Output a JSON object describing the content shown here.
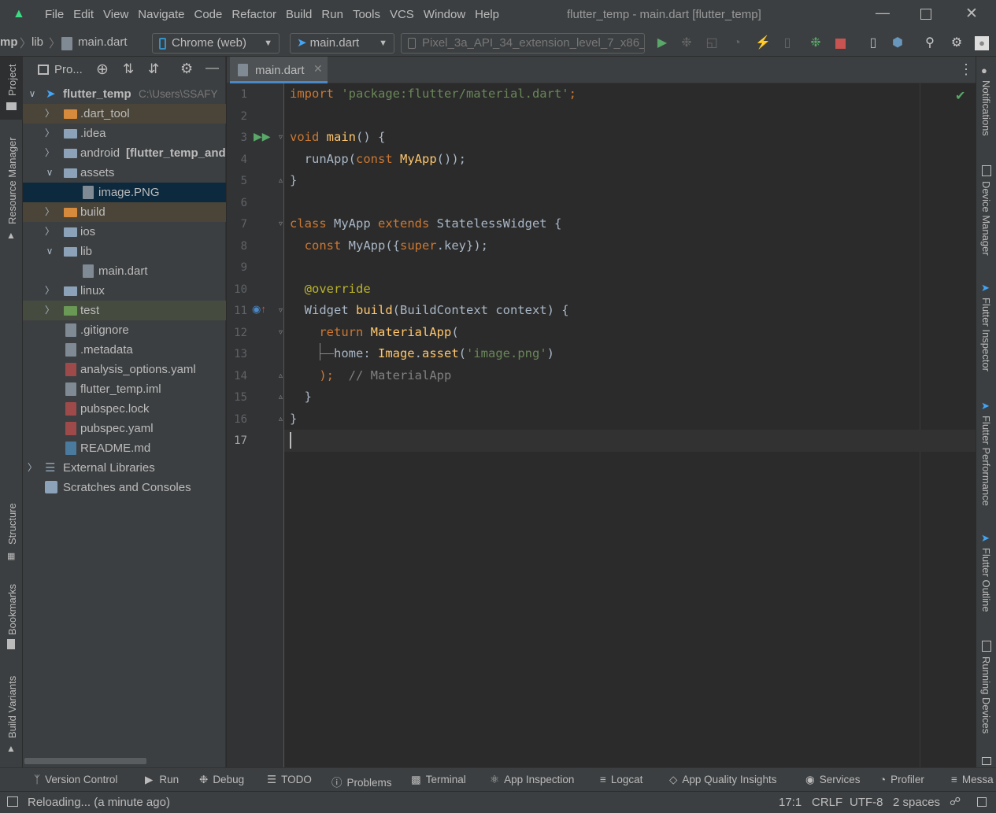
{
  "menu": [
    "File",
    "Edit",
    "View",
    "Navigate",
    "Code",
    "Refactor",
    "Build",
    "Run",
    "Tools",
    "VCS",
    "Window",
    "Help"
  ],
  "window_title": "flutter_temp - main.dart [flutter_temp]",
  "breadcrumb": {
    "part1": "mp",
    "part2": "lib",
    "file": "main.dart"
  },
  "run_config": {
    "device": "Chrome (web)",
    "target": "main.dart",
    "emulator": "Pixel_3a_API_34_extension_level_7_x86_..."
  },
  "project_panel": {
    "title": "Pro...",
    "root_name": "flutter_temp",
    "root_path": "C:\\Users\\SSAFY",
    "items": [
      {
        "label": ".dart_tool"
      },
      {
        "label": ".idea"
      },
      {
        "label": "android",
        "suffix": "[flutter_temp_andr"
      },
      {
        "label": "assets"
      },
      {
        "label": "image.PNG"
      },
      {
        "label": "build"
      },
      {
        "label": "ios"
      },
      {
        "label": "lib"
      },
      {
        "label": "main.dart"
      },
      {
        "label": "linux"
      },
      {
        "label": "test"
      },
      {
        "label": ".gitignore"
      },
      {
        "label": ".metadata"
      },
      {
        "label": "analysis_options.yaml"
      },
      {
        "label": "flutter_temp.iml"
      },
      {
        "label": "pubspec.lock"
      },
      {
        "label": "pubspec.yaml"
      },
      {
        "label": "README.md"
      },
      {
        "label": "External Libraries"
      },
      {
        "label": "Scratches and Consoles"
      }
    ]
  },
  "editor_tab": "main.dart",
  "line_numbers": [
    "1",
    "2",
    "3",
    "4",
    "5",
    "6",
    "7",
    "8",
    "9",
    "10",
    "11",
    "12",
    "13",
    "14",
    "15",
    "16",
    "17"
  ],
  "code": {
    "l1a": "import ",
    "l1b": "'package:flutter/material.dart'",
    "l1c": ";",
    "l3a": "void ",
    "l3b": "main",
    "l3c": "() {",
    "l4a": "  runApp(",
    "l4b": "const ",
    "l4c": "MyApp",
    "l4d": "());",
    "l5": "}",
    "l7a": "class ",
    "l7b": "MyApp ",
    "l7c": "extends ",
    "l7d": "StatelessWidget {",
    "l8a": "  const ",
    "l8b": "MyApp({",
    "l8c": "super",
    "l8d": ".key});",
    "l10a": "  @",
    "l10b": "override",
    "l11a": "  Widget ",
    "l11b": "build",
    "l11c": "(BuildContext context) {",
    "l12a": "    return ",
    "l12b": "MaterialApp",
    "l12c": "(",
    "l13a": "      home: ",
    "l13b": "Image",
    "l13c": ".",
    "l13d": "asset",
    "l13e": "(",
    "l13f": "'image.png'",
    "l13g": ")",
    "l14a": "    );",
    "l14b": "  // MaterialApp",
    "l15": "  }",
    "l16": "}"
  },
  "left_tool_tabs": {
    "project": "Project",
    "resource_manager": "Resource Manager",
    "structure": "Structure",
    "bookmarks": "Bookmarks",
    "build_variants": "Build Variants"
  },
  "right_tool_tabs": {
    "notifications": "Notifications",
    "device_manager": "Device Manager",
    "flutter_inspector": "Flutter Inspector",
    "flutter_performance": "Flutter Performance",
    "flutter_outline": "Flutter Outline",
    "running_devices": "Running Devices"
  },
  "bottom_tabs": [
    "Version Control",
    "Run",
    "Debug",
    "TODO",
    "Problems",
    "Terminal",
    "App Inspection",
    "Logcat",
    "App Quality Insights",
    "Services",
    "Profiler",
    "Messa"
  ],
  "status": {
    "message": "Reloading... (a minute ago)",
    "position": "17:1",
    "line_sep": "CRLF",
    "encoding": "UTF-8",
    "indent": "2 spaces"
  }
}
